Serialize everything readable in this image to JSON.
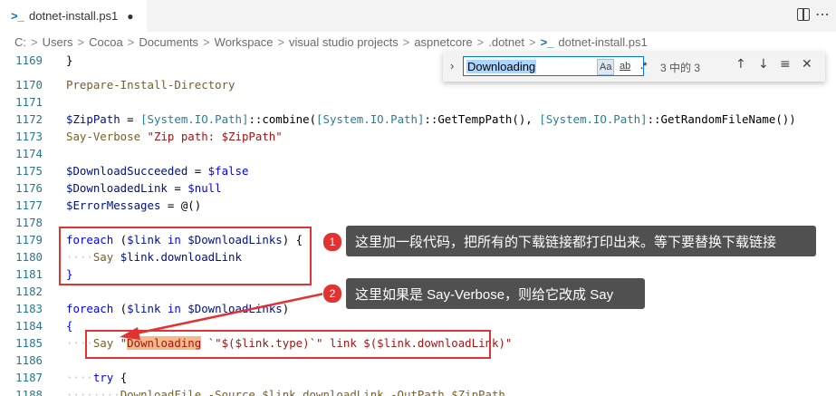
{
  "tab": {
    "icon": "powershell-icon",
    "filename": "dotnet-install.ps1",
    "modified_indicator": "●"
  },
  "breadcrumb": {
    "items": [
      "C:",
      "Users",
      "Cocoa",
      "Documents",
      "Workspace",
      "visual studio projects",
      "aspnetcore",
      ".dotnet",
      "dotnet-install.ps1"
    ],
    "separator": ">"
  },
  "find_widget": {
    "query": "Downloading",
    "match_case_label": "Aa",
    "whole_word_label": "ab",
    "regex_label": ".*",
    "result_count": "3 中的 3",
    "prev_icon": "arrow-up-icon",
    "next_icon": "arrow-down-icon",
    "selection_icon": "find-in-selection-icon",
    "close_icon": "close-icon"
  },
  "line_numbers": [
    "1169",
    "1170",
    "1171",
    "1172",
    "1173",
    "1174",
    "1175",
    "1176",
    "1177",
    "1178",
    "1179",
    "1180",
    "1181",
    "1182",
    "1183",
    "1184",
    "1185",
    "1186",
    "1187",
    "1188"
  ],
  "code": {
    "l1169": "}",
    "l1170": "Prepare-Install-Directory",
    "l1172_var": "$ZipPath",
    "l1172_eq": " = ",
    "l1172_t1": "[System.IO.Path]",
    "l1172_m1": "::combine(",
    "l1172_t2": "[System.IO.Path]",
    "l1172_m2": "::GetTempPath(), ",
    "l1172_t3": "[System.IO.Path]",
    "l1172_m3": "::GetRandomFileName())",
    "l1173_cmd": "Say-Verbose ",
    "l1173_str": "\"Zip path: $ZipPath\"",
    "l1175_var": "$DownloadSucceeded",
    "l1175_eq": " = ",
    "l1175_val": "$false",
    "l1176_var": "$DownloadedLink",
    "l1176_eq": " = ",
    "l1176_val": "$null",
    "l1177_var": "$ErrorMessages",
    "l1177_eq": " = @()",
    "l1179_kw": "foreach",
    "l1179_a": " (",
    "l1179_v1": "$link",
    "l1179_in": " in ",
    "l1179_v2": "$DownloadLinks",
    "l1179_b": ") {",
    "l1180_ws": "····",
    "l1180_cmd": "Say ",
    "l1180_v": "$link",
    "l1180_p": ".downloadLink",
    "l1181": "}",
    "l1183_kw": "foreach",
    "l1183_a": " (",
    "l1183_v1": "$link",
    "l1183_in": " in ",
    "l1183_v2": "$DownloadLinks",
    "l1183_b": ")",
    "l1184": "{",
    "l1185_ws": "····",
    "l1185_cmd": "Say ",
    "l1185_q": "\"",
    "l1185_hl": "Downloading",
    "l1185_rest": " `\"$($link.type)`\" link $($link.downloadLink)\"",
    "l1187_ws": "····",
    "l1187_kw": "try",
    "l1187_b": " {",
    "l1188_ws": "········",
    "l1188_code": "DownloadFile -Source $link.downloadLink -OutPath $ZipPath"
  },
  "annotations": [
    {
      "number": "1",
      "text": "这里加一段代码，把所有的下载链接都打印出来。等下要替换下载链接"
    },
    {
      "number": "2",
      "text": "这里如果是 Say-Verbose，则给它改成 Say"
    }
  ],
  "colors": {
    "annotation_red": "#e33232",
    "callout_bg": "#505050",
    "search_highlight": "#f6b98a"
  }
}
